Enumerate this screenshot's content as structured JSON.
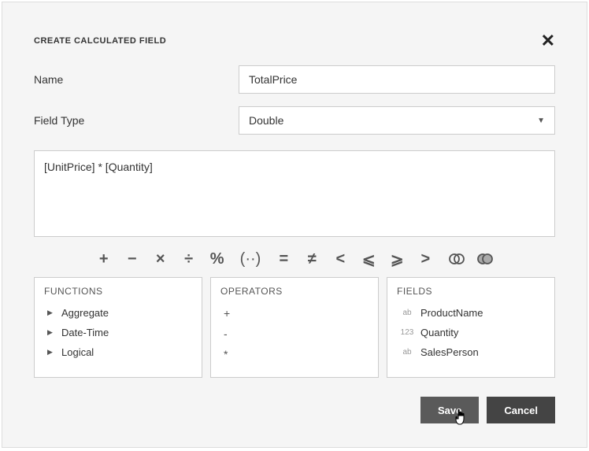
{
  "title": "CREATE CALCULATED FIELD",
  "form": {
    "name_label": "Name",
    "name_value": "TotalPrice",
    "type_label": "Field Type",
    "type_value": "Double"
  },
  "expression": "[UnitPrice] * [Quantity]",
  "operators_bar": {
    "plus": "+",
    "minus": "−",
    "multiply": "×",
    "divide": "÷",
    "percent": "%",
    "paren": "(··)",
    "equals": "=",
    "neq": "≠",
    "lt": "<",
    "lte": "⩽",
    "gte": "⩾",
    "gt": ">",
    "join1": "◎",
    "join2": "◎"
  },
  "panels": {
    "functions": {
      "header": "FUNCTIONS",
      "items": [
        "Aggregate",
        "Date-Time",
        "Logical"
      ]
    },
    "operators": {
      "header": "OPERATORS",
      "items": [
        "+",
        "-",
        "*"
      ]
    },
    "fields": {
      "header": "FIELDS",
      "items": [
        {
          "type": "ab",
          "name": "ProductName"
        },
        {
          "type": "123",
          "name": "Quantity"
        },
        {
          "type": "ab",
          "name": "SalesPerson"
        }
      ]
    }
  },
  "buttons": {
    "save": "Save",
    "cancel": "Cancel"
  }
}
